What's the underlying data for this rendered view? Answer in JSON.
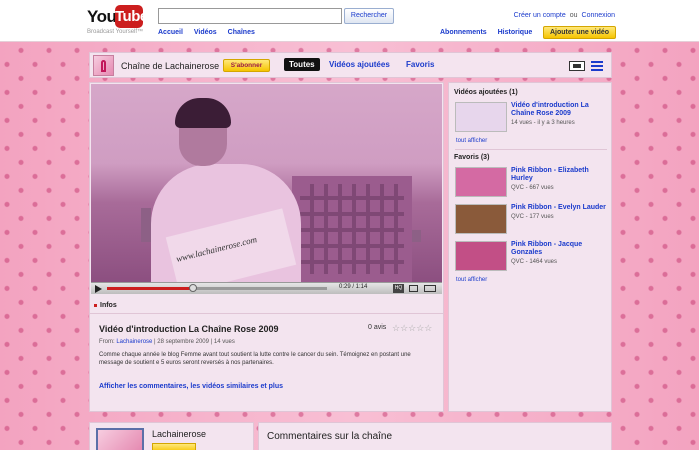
{
  "header": {
    "logo_you": "You",
    "logo_tube": "Tube",
    "tagline": "Broadcast Yourself™",
    "search_placeholder": "",
    "search_button": "Rechercher",
    "nav": [
      "Accueil",
      "Vidéos",
      "Chaînes"
    ],
    "create_account": "Créer un compte",
    "or": "ou",
    "login": "Connexion",
    "subscriptions": "Abonnements",
    "history": "Historique",
    "upload": "Ajouter une vidéo"
  },
  "channel": {
    "title": "Chaîne de Lachainerose",
    "subscribe": "S'abonner",
    "tabs": [
      "Toutes",
      "Vidéos ajoutées",
      "Favoris"
    ],
    "active_tab": "Toutes"
  },
  "player": {
    "sign_text": "www.lachainerose.com",
    "time": "0:29 / 1:14",
    "progress_percent": 39,
    "hq": "HQ"
  },
  "video_info": {
    "tab": "Infos",
    "title": "Vidéo d'introduction La Chaîne Rose 2009",
    "rating_text": "0 avis",
    "stars": "☆☆☆☆☆",
    "from_label": "From:",
    "author": "Lachainerose",
    "date_views": " | 28 septembre 2009 | 14 vues",
    "description": "Comme chaque année le blog Femme avant tout soutient la lutte contre le cancer du sein. Témoignez en postant une message de soutient e 5 euros seront reversés à nos partenaires.",
    "more": "Afficher les commentaires, les vidéos similaires et plus"
  },
  "sidebar": {
    "uploads_heading": "Vidéos ajoutées (1)",
    "uploads": [
      {
        "title": "Vidéo d'introduction La Chaîne Rose 2009",
        "sub": "14 vues - il y a 3 heures",
        "thumb_color": "#e7d6ec"
      }
    ],
    "uploads_see_all": "tout afficher",
    "favorites_heading": "Favoris (3)",
    "favorites": [
      {
        "title": "Pink Ribbon - Elizabeth Hurley",
        "sub": "QVC - 667 vues",
        "thumb_color": "#d46aa3"
      },
      {
        "title": "Pink Ribbon - Evelyn Lauder",
        "sub": "QVC - 177 vues",
        "thumb_color": "#8a5a3a"
      },
      {
        "title": "Pink Ribbon - Jacque Gonzales",
        "sub": "QVC - 1464 vues",
        "thumb_color": "#c24f86"
      }
    ],
    "favorites_see_all": "tout afficher"
  },
  "bottom": {
    "channel_name": "Lachainerose",
    "comments_title": "Commentaires sur la chaîne"
  }
}
